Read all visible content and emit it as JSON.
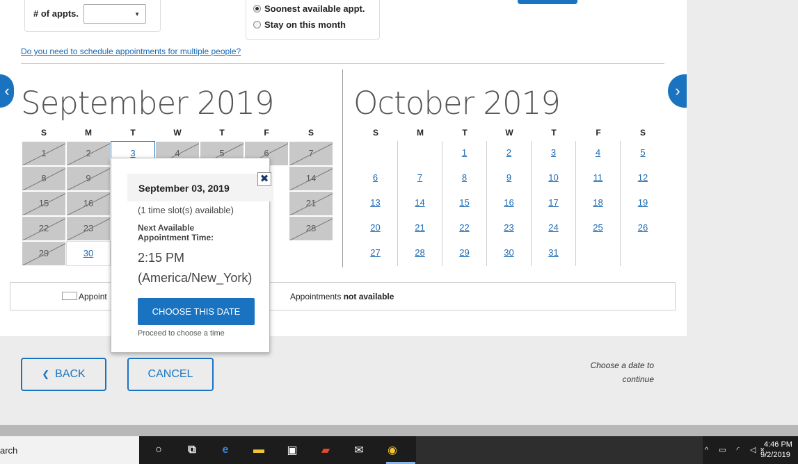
{
  "controls": {
    "appts_label": "# of appts.",
    "select_value": "",
    "caret": "▼",
    "radio_soonest": "Soonest available appt.",
    "radio_stay": "Stay on this month"
  },
  "multi_link": "Do you need to schedule appointments for multiple people?",
  "nav": {
    "prev": "‹",
    "next": "›"
  },
  "dow": [
    "S",
    "M",
    "T",
    "W",
    "T",
    "F",
    "S"
  ],
  "september": {
    "title": "September 2019",
    "rows": [
      [
        {
          "d": "1",
          "s": "na"
        },
        {
          "d": "2",
          "s": "na"
        },
        {
          "d": "3",
          "s": "sel"
        },
        {
          "d": "4",
          "s": "na"
        },
        {
          "d": "5",
          "s": "na"
        },
        {
          "d": "6",
          "s": "na"
        },
        {
          "d": "7",
          "s": "na"
        }
      ],
      [
        {
          "d": "8",
          "s": "na"
        },
        {
          "d": "9",
          "s": "na"
        },
        {
          "d": "",
          "s": "hidden"
        },
        {
          "d": "",
          "s": "hidden"
        },
        {
          "d": "",
          "s": "hidden"
        },
        {
          "d": "",
          "s": "hidden"
        },
        {
          "d": "14",
          "s": "na"
        }
      ],
      [
        {
          "d": "15",
          "s": "na"
        },
        {
          "d": "16",
          "s": "na"
        },
        {
          "d": "",
          "s": "hidden"
        },
        {
          "d": "",
          "s": "hidden"
        },
        {
          "d": "",
          "s": "hidden"
        },
        {
          "d": "",
          "s": "hidden"
        },
        {
          "d": "21",
          "s": "na"
        }
      ],
      [
        {
          "d": "22",
          "s": "na"
        },
        {
          "d": "23",
          "s": "na"
        },
        {
          "d": "",
          "s": "hidden"
        },
        {
          "d": "",
          "s": "hidden"
        },
        {
          "d": "",
          "s": "hidden"
        },
        {
          "d": "",
          "s": "hidden"
        },
        {
          "d": "28",
          "s": "na"
        }
      ],
      [
        {
          "d": "29",
          "s": "na"
        },
        {
          "d": "30",
          "s": "av"
        },
        {
          "d": "",
          "s": "empty"
        },
        {
          "d": "",
          "s": "empty"
        },
        {
          "d": "",
          "s": "empty"
        },
        {
          "d": "",
          "s": "empty"
        },
        {
          "d": "",
          "s": "empty"
        }
      ]
    ]
  },
  "october": {
    "title": "October 2019",
    "rows": [
      [
        "",
        "",
        "1",
        "2",
        "3",
        "4",
        "5"
      ],
      [
        "6",
        "7",
        "8",
        "9",
        "10",
        "11",
        "12"
      ],
      [
        "13",
        "14",
        "15",
        "16",
        "17",
        "18",
        "19"
      ],
      [
        "20",
        "21",
        "22",
        "23",
        "24",
        "25",
        "26"
      ],
      [
        "27",
        "28",
        "29",
        "30",
        "31",
        "",
        ""
      ]
    ]
  },
  "legend": {
    "available_text": "Appoint",
    "unavailable_prefix": "Appointments ",
    "unavailable_bold": "not available"
  },
  "popup": {
    "date": "September 03, 2019",
    "close": "✖",
    "slots": "(1 time slot(s) available)",
    "next_label": "Next Available Appointment Time:",
    "time": "2:15 PM",
    "timezone": "(America/New_York)",
    "choose_label": "CHOOSE THIS DATE",
    "proceed": "Proceed to choose a time"
  },
  "footer": {
    "back_icon": "❮",
    "back_label": "BACK",
    "cancel_label": "CANCEL",
    "choose_note": "Choose a date to continue"
  },
  "taskbar": {
    "search_text": "arch",
    "icons": [
      "cortana-icon",
      "task-view-icon",
      "edge-icon",
      "file-explorer-icon",
      "store-icon",
      "office-icon",
      "mail-icon",
      "chrome-icon"
    ],
    "icon_glyphs": [
      "○",
      "⧉",
      "e",
      "▬",
      "▣",
      "▰",
      "✉",
      "◉"
    ],
    "icon_colors": [
      "#ffffff",
      "#ffffff",
      "#2f8ae0",
      "#f1c232",
      "#ffffff",
      "#e8472a",
      "#ffffff",
      "#f1c232"
    ],
    "tray_icons": "^ ▭ ◜ ◁×",
    "time": "4:46 PM",
    "date": "9/2/2019"
  },
  "colors": {
    "accent": "#1a73c0",
    "unavailable": "#c8c8c8",
    "link": "#1a6ab3"
  }
}
